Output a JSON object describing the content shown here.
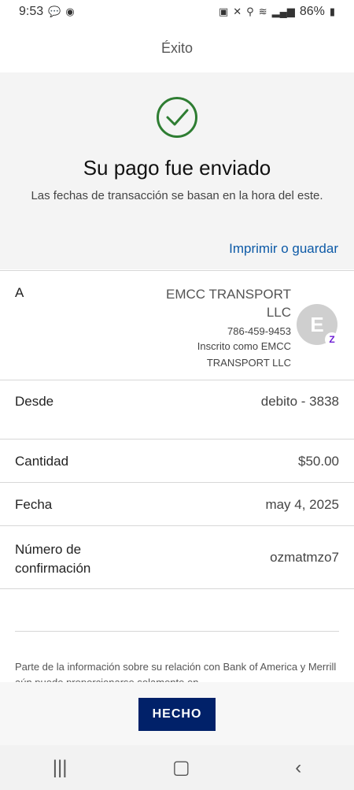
{
  "status_bar": {
    "time": "9:53",
    "battery": "86%"
  },
  "header": {
    "title": "Éxito"
  },
  "confirmation": {
    "headline": "Su pago fue enviado",
    "subtext": "Las fechas de transacción se basan en la hora del este.",
    "print_link": "Imprimir o guardar",
    "accent_color": "#0d5aa7",
    "success_color": "#2e7d32"
  },
  "recipient": {
    "label": "A",
    "name_line1": "EMCC TRANSPORT",
    "name_line2": "LLC",
    "phone": "786-459-9453",
    "enrolled_line1": "Inscrito como EMCC",
    "enrolled_line2": "TRANSPORT LLC",
    "avatar_initial": "E",
    "badge_icon": "zelle-icon"
  },
  "details": {
    "from_label": "Desde",
    "from_value": "debito - 3838",
    "amount_label": "Cantidad",
    "amount_value": "$50.00",
    "date_label": "Fecha",
    "date_value": "may 4, 2025",
    "confirmation_label_line1": "Número de",
    "confirmation_label_line2": "confirmación",
    "confirmation_value": "ozmatmzo7"
  },
  "disclaimer": "Parte de la información sobre su relación con Bank of America y Merrill aún puede proporcionarse solamente en",
  "footer": {
    "done_label": "HECHO",
    "button_color": "#012169"
  },
  "nav": {
    "recents_icon": "recents-icon",
    "home_icon": "home-icon",
    "back_icon": "back-icon"
  }
}
